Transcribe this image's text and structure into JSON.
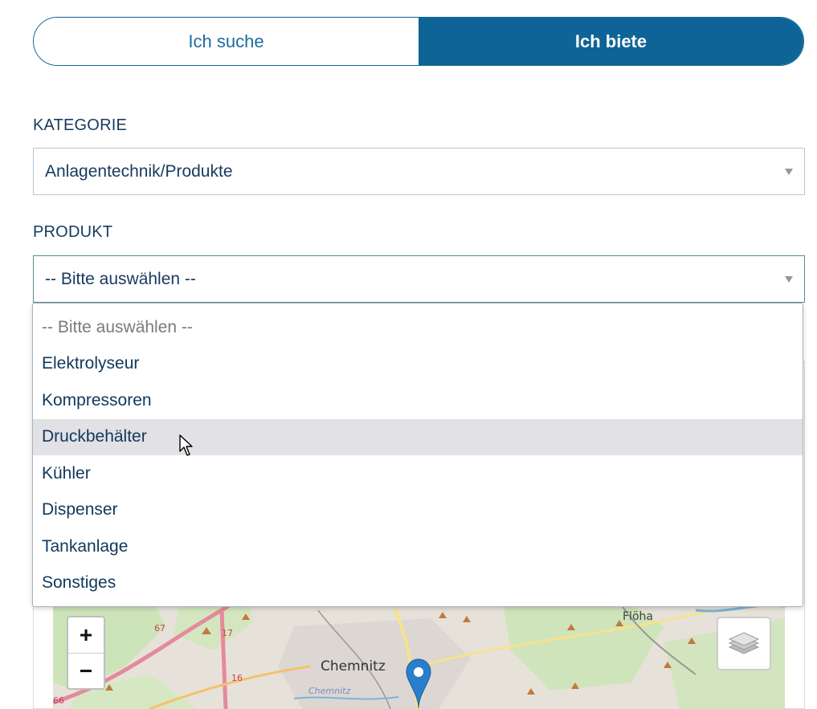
{
  "toggle": {
    "search_label": "Ich suche",
    "offer_label": "Ich biete",
    "active": "offer"
  },
  "kategorie": {
    "label": "KATEGORIE",
    "value": "Anlagentechnik/Produkte"
  },
  "produkt": {
    "label": "PRODUKT",
    "value": "-- Bitte auswählen --",
    "options": [
      "-- Bitte auswählen --",
      "Elektrolyseur",
      "Kompressoren",
      "Druckbehälter",
      "Kühler",
      "Dispenser",
      "Tankanlage",
      "Sonstiges"
    ],
    "hovered_option": "Druckbehälter"
  },
  "map": {
    "zoom_in": "+",
    "zoom_out": "−",
    "city": "Chemnitz",
    "city_small": "Chemnitz",
    "town": "Flöha",
    "road_labels": [
      "67",
      "17",
      "16",
      "66"
    ],
    "layers_icon": "layers-icon",
    "marker_icon": "map-marker-icon",
    "marker_color": "#2a7fcc"
  },
  "colors": {
    "primary": "#0f6497",
    "text": "#173a5e",
    "hover_bg": "#e1e1e6"
  }
}
